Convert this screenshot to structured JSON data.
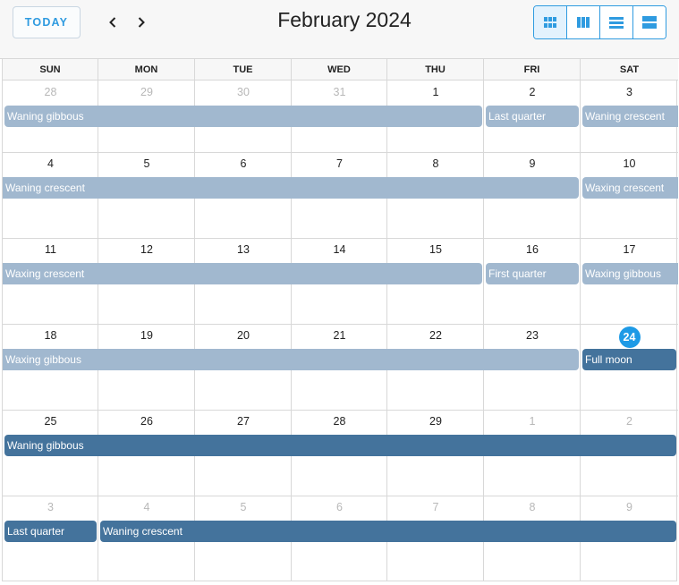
{
  "toolbar": {
    "today_label": "TODAY",
    "prev_icon": "chevron-left-icon",
    "next_icon": "chevron-right-icon",
    "title": "February 2024",
    "views": [
      {
        "icon": "month-grid-icon",
        "active": true
      },
      {
        "icon": "week-columns-icon",
        "active": false
      },
      {
        "icon": "day-rows-icon",
        "active": false
      },
      {
        "icon": "agenda-list-icon",
        "active": false
      }
    ]
  },
  "weekdays": [
    "SUN",
    "MON",
    "TUE",
    "WED",
    "THU",
    "FRI",
    "SAT"
  ],
  "colors": {
    "accent": "#2f9be0",
    "today": "#1e9ae6",
    "event_light": "#a1b8cf",
    "event_dark": "#44739c"
  },
  "weeks": [
    {
      "days": [
        {
          "label": "28",
          "muted": true
        },
        {
          "label": "29",
          "muted": true
        },
        {
          "label": "30",
          "muted": true
        },
        {
          "label": "31",
          "muted": true
        },
        {
          "label": "1",
          "muted": false
        },
        {
          "label": "2",
          "muted": false
        },
        {
          "label": "3",
          "muted": false
        }
      ],
      "events": [
        {
          "title": "Waning gibbous",
          "tone": "light"
        },
        {
          "title": "Last quarter",
          "tone": "light"
        },
        {
          "title": "Waning crescent",
          "tone": "light"
        }
      ]
    },
    {
      "days": [
        {
          "label": "4",
          "muted": false
        },
        {
          "label": "5",
          "muted": false
        },
        {
          "label": "6",
          "muted": false
        },
        {
          "label": "7",
          "muted": false
        },
        {
          "label": "8",
          "muted": false
        },
        {
          "label": "9",
          "muted": false
        },
        {
          "label": "10",
          "muted": false
        }
      ],
      "events": [
        {
          "title": "Waning crescent",
          "tone": "light"
        },
        {
          "title": "Waxing crescent",
          "tone": "light"
        }
      ]
    },
    {
      "days": [
        {
          "label": "11",
          "muted": false
        },
        {
          "label": "12",
          "muted": false
        },
        {
          "label": "13",
          "muted": false
        },
        {
          "label": "14",
          "muted": false
        },
        {
          "label": "15",
          "muted": false
        },
        {
          "label": "16",
          "muted": false
        },
        {
          "label": "17",
          "muted": false
        }
      ],
      "events": [
        {
          "title": "Waxing crescent",
          "tone": "light"
        },
        {
          "title": "First quarter",
          "tone": "light"
        },
        {
          "title": "Waxing gibbous",
          "tone": "light"
        }
      ]
    },
    {
      "days": [
        {
          "label": "18",
          "muted": false
        },
        {
          "label": "19",
          "muted": false
        },
        {
          "label": "20",
          "muted": false
        },
        {
          "label": "21",
          "muted": false
        },
        {
          "label": "22",
          "muted": false
        },
        {
          "label": "23",
          "muted": false
        },
        {
          "label": "24",
          "muted": false,
          "today": true
        }
      ],
      "events": [
        {
          "title": "Waxing gibbous",
          "tone": "light"
        },
        {
          "title": "Full moon",
          "tone": "dark"
        }
      ]
    },
    {
      "days": [
        {
          "label": "25",
          "muted": false
        },
        {
          "label": "26",
          "muted": false
        },
        {
          "label": "27",
          "muted": false
        },
        {
          "label": "28",
          "muted": false
        },
        {
          "label": "29",
          "muted": false
        },
        {
          "label": "1",
          "muted": true
        },
        {
          "label": "2",
          "muted": true
        }
      ],
      "events": [
        {
          "title": "Waning gibbous",
          "tone": "dark"
        }
      ]
    },
    {
      "days": [
        {
          "label": "3",
          "muted": true
        },
        {
          "label": "4",
          "muted": true
        },
        {
          "label": "5",
          "muted": true
        },
        {
          "label": "6",
          "muted": true
        },
        {
          "label": "7",
          "muted": true
        },
        {
          "label": "8",
          "muted": true
        },
        {
          "label": "9",
          "muted": true
        }
      ],
      "events": [
        {
          "title": "Last quarter",
          "tone": "dark"
        },
        {
          "title": "Waning crescent",
          "tone": "dark"
        }
      ]
    }
  ]
}
